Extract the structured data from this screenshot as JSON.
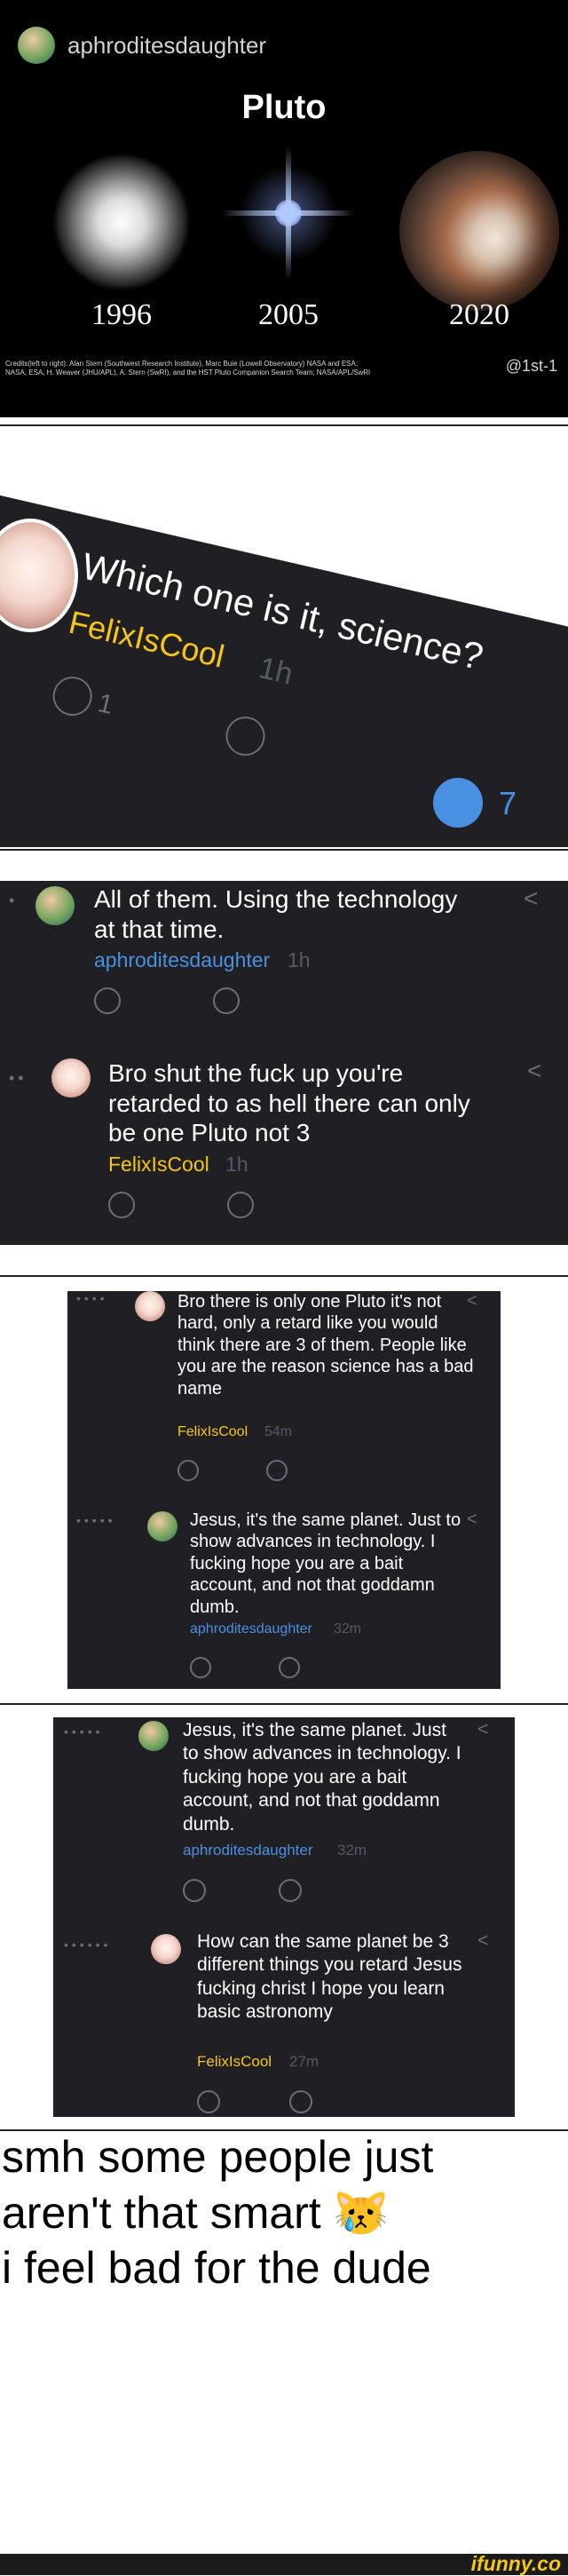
{
  "panel1": {
    "username": "aphroditesdaughter",
    "title": "Pluto",
    "years": [
      "1996",
      "2005",
      "2020"
    ],
    "credits_line1": "Credits(left to right): Alan Stern (Southwest Research Institute), Marc Buie (Lowell Observatory) NASA and ESA;",
    "credits_line2": "NASA, ESA, H. Weaver (JHU/APL), A. Stern (SwRI), and the HST Pluto Companion Search Team; NASA/APL/SwRI",
    "handle": "@1st-1"
  },
  "panel2": {
    "text": "Which one is it, science?",
    "username": "FelixIsCool",
    "time": "1h",
    "count_left": "1",
    "count_right": "7"
  },
  "panel3": {
    "comment1": {
      "text": "All of them. Using the technology at that time.",
      "username": "aphroditesdaughter",
      "time": "1h"
    },
    "comment2": {
      "text": "Bro shut the fuck up you're retarded to as hell there can only be one Pluto not 3",
      "username": "FelixIsCool",
      "time": "1h"
    }
  },
  "panel4": {
    "comment1": {
      "text": "Bro there is only one Pluto it's not hard, only a retard like you would think there are 3 of them. People like you are the reason science has a bad name",
      "username": "FelixIsCool",
      "time": "54m"
    },
    "comment2": {
      "text": "Jesus, it's the same planet. Just to show advances in technology. I fucking hope you are a bait account, and not that goddamn dumb.",
      "username": "aphroditesdaughter",
      "time": "32m"
    }
  },
  "panel5": {
    "comment1": {
      "text": "Jesus, it's the same planet. Just to show advances in technology. I fucking hope you are a bait account, and not that goddamn dumb.",
      "username": "aphroditesdaughter",
      "time": "32m"
    },
    "comment2": {
      "text": "How can the same planet be 3 different things you retard Jesus fucking christ I hope you learn basic astronomy",
      "username": "FelixIsCool",
      "time": "27m"
    }
  },
  "caption": {
    "line1": "smh some people just",
    "line2": "aren't that smart",
    "emoji": "😿",
    "line3": "i feel bad for the dude"
  },
  "footer": {
    "brand": "ifunny.co"
  },
  "icons": [
    "face-icon",
    "share-icon",
    "avatar-icon",
    "pluto-image"
  ],
  "colors": {
    "accent_blue": "#4a90e2",
    "accent_yellow": "#f5c518",
    "comment_bg": "#202024"
  }
}
